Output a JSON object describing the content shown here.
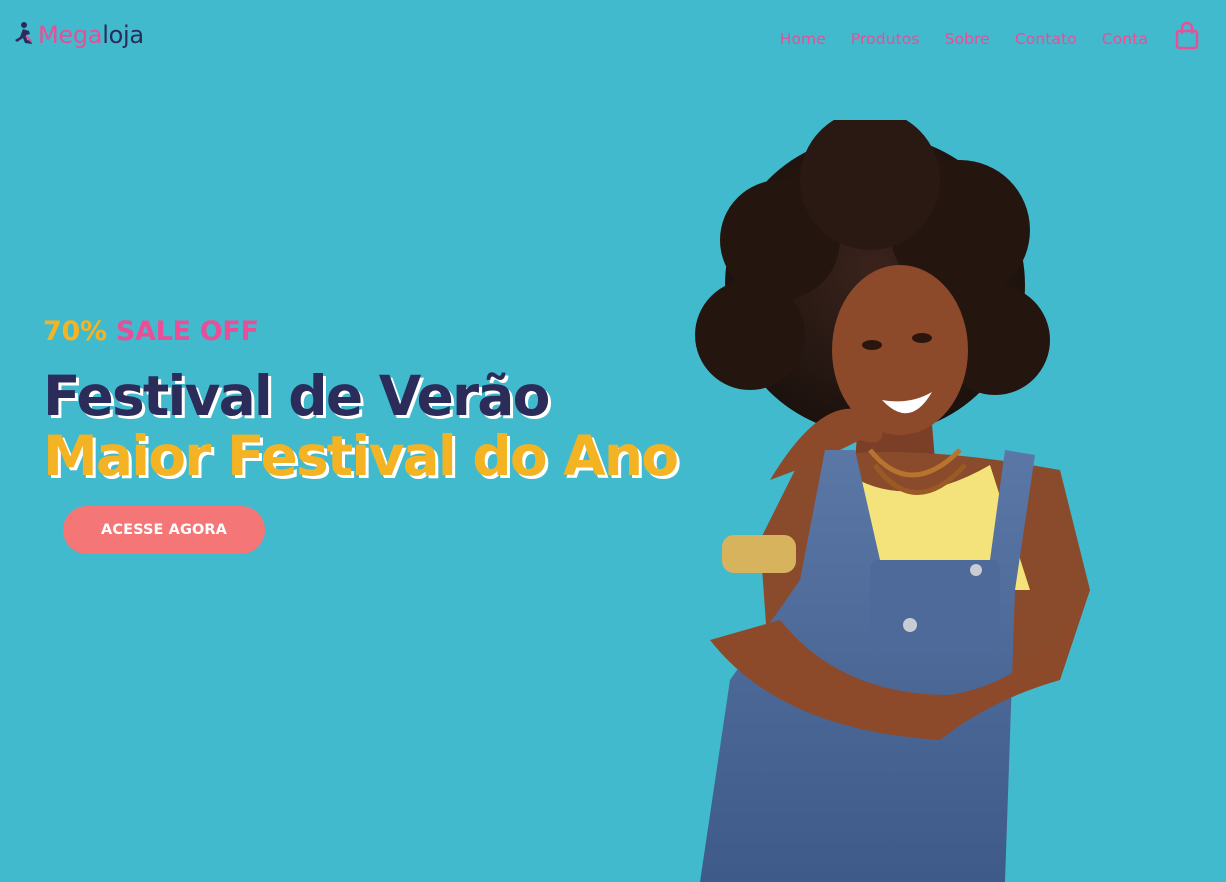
{
  "header": {
    "logo": {
      "icon": "running-figure-icon",
      "part1": "Mega",
      "part2": "loja"
    },
    "nav": [
      {
        "label": "Home"
      },
      {
        "label": "Produtos"
      },
      {
        "label": "Sobre"
      },
      {
        "label": "Contato"
      },
      {
        "label": "Conta"
      }
    ],
    "cart_icon": "shopping-bag-icon"
  },
  "hero": {
    "promo_percent": "70%",
    "promo_text": "SALE OFF",
    "title_line1": "Festival de Verão",
    "title_line2": "Maior Festival do Ano",
    "cta_label": "ACESSE AGORA",
    "image": "smiling-woman-in-denim-overalls-photo"
  },
  "colors": {
    "background": "#42bacd",
    "brand_pink": "#e94e96",
    "navy": "#2b2c5a",
    "yellow": "#f4b323",
    "cta": "#f47676"
  }
}
